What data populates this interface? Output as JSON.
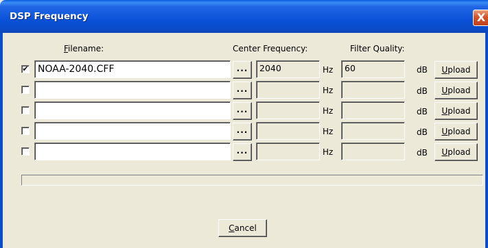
{
  "window": {
    "title": "DSP Frequency",
    "close_label": "X"
  },
  "headers": {
    "filename": {
      "pre": "",
      "accel": "F",
      "post": "ilename:"
    },
    "center_frequency": "Center Frequency:",
    "filter_quality": "Filter Quality:"
  },
  "rows": [
    {
      "checked": "✔",
      "filename": "NOAA-2040.CFF",
      "browse_label": "...",
      "frequency": "2040",
      "freq_unit": "Hz",
      "quality": "60",
      "quality_unit": "dB",
      "upload": {
        "accel": "U",
        "rest": "pload"
      }
    },
    {
      "checked": "",
      "filename": "",
      "browse_label": "...",
      "frequency": "",
      "freq_unit": "Hz",
      "quality": "",
      "quality_unit": "dB",
      "upload": {
        "accel": "U",
        "rest": "pload"
      }
    },
    {
      "checked": "",
      "filename": "",
      "browse_label": "...",
      "frequency": "",
      "freq_unit": "Hz",
      "quality": "",
      "quality_unit": "dB",
      "upload": {
        "accel": "U",
        "rest": "pload"
      }
    },
    {
      "checked": "",
      "filename": "",
      "browse_label": "...",
      "frequency": "",
      "freq_unit": "Hz",
      "quality": "",
      "quality_unit": "dB",
      "upload": {
        "accel": "U",
        "rest": "pload"
      }
    },
    {
      "checked": "",
      "filename": "",
      "browse_label": "...",
      "frequency": "",
      "freq_unit": "Hz",
      "quality": "",
      "quality_unit": "dB",
      "upload": {
        "accel": "U",
        "rest": "pload"
      }
    }
  ],
  "progress": {
    "fraction": 0
  },
  "cancel": {
    "accel": "C",
    "rest": "ancel"
  },
  "colors": {
    "title_bar": "#0a52d8",
    "dialog_bg": "#ece9d8",
    "close_button": "#d2542a"
  }
}
